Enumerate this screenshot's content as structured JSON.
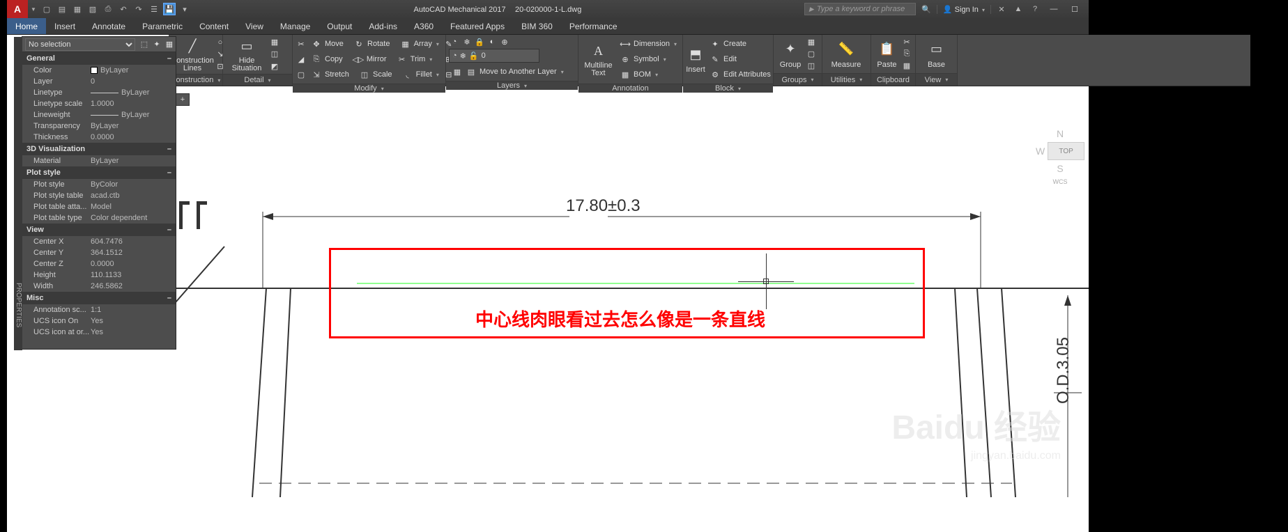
{
  "title": {
    "app": "AutoCAD Mechanical 2017",
    "file": "20-020000-1-L.dwg"
  },
  "search": {
    "placeholder": "Type a keyword or phrase"
  },
  "signin": "Sign In",
  "tabs": [
    "Home",
    "Insert",
    "Annotate",
    "Parametric",
    "Content",
    "View",
    "Manage",
    "Output",
    "Add-ins",
    "A360",
    "Featured Apps",
    "BIM 360",
    "Performance"
  ],
  "ribbon": {
    "construction": {
      "big": "Construction\nLines",
      "title": "Construction"
    },
    "detail": {
      "big": "Hide\nSituation",
      "title": "Detail"
    },
    "modify": {
      "r1": [
        "Move",
        "Rotate",
        "Array"
      ],
      "r2": [
        "Copy",
        "Mirror",
        "Trim"
      ],
      "r3": [
        "Stretch",
        "Scale",
        "Fillet"
      ],
      "title": "Modify"
    },
    "layers": {
      "combo": "0",
      "move": "Move to Another Layer",
      "title": "Layers"
    },
    "annotation": {
      "big": "Multiline\nText",
      "r1": "Dimension",
      "r2": "Symbol",
      "r3": "BOM",
      "title": "Annotation"
    },
    "block": {
      "big": "Insert",
      "r1": "Create",
      "r2": "Edit",
      "r3": "Edit Attributes",
      "title": "Block"
    },
    "groups": {
      "big": "Group",
      "title": "Groups"
    },
    "utilities": {
      "big": "Measure",
      "title": "Utilities"
    },
    "clipboard": {
      "big": "Paste",
      "title": "Clipboard"
    },
    "view": {
      "big": "Base",
      "title": "View"
    }
  },
  "props": {
    "selection": "No selection",
    "cats": [
      {
        "name": "General",
        "rows": [
          [
            "Color",
            "ByLayer",
            "swatch"
          ],
          [
            "Layer",
            "0"
          ],
          [
            "Linetype",
            "ByLayer",
            "line"
          ],
          [
            "Linetype scale",
            "1.0000"
          ],
          [
            "Lineweight",
            "ByLayer",
            "line"
          ],
          [
            "Transparency",
            "ByLayer"
          ],
          [
            "Thickness",
            "0.0000"
          ]
        ]
      },
      {
        "name": "3D Visualization",
        "rows": [
          [
            "Material",
            "ByLayer"
          ]
        ]
      },
      {
        "name": "Plot style",
        "rows": [
          [
            "Plot style",
            "ByColor"
          ],
          [
            "Plot style table",
            "acad.ctb"
          ],
          [
            "Plot table atta...",
            "Model"
          ],
          [
            "Plot table type",
            "Color dependent"
          ]
        ]
      },
      {
        "name": "View",
        "rows": [
          [
            "Center X",
            "604.7476"
          ],
          [
            "Center Y",
            "364.1512"
          ],
          [
            "Center Z",
            "0.0000"
          ],
          [
            "Height",
            "110.1133"
          ],
          [
            "Width",
            "246.5862"
          ]
        ]
      },
      {
        "name": "Misc",
        "rows": [
          [
            "Annotation sc...",
            "1:1"
          ],
          [
            "UCS icon On",
            "Yes"
          ],
          [
            "UCS icon at or...",
            "Yes"
          ]
        ]
      }
    ],
    "tab_label": "PROPERTIES"
  },
  "canvas": {
    "dim_top": "17.80±0.3",
    "dim_right": "O.D.3.05",
    "annotation": "中心线肉眼看过去怎么像是一条直线",
    "nav": {
      "n": "N",
      "w": "W",
      "top": "TOP",
      "s": "S",
      "wcs": "WCS"
    },
    "watermark": "Baidu 经验",
    "watermark_sub": "jingyan.baidu.com"
  }
}
